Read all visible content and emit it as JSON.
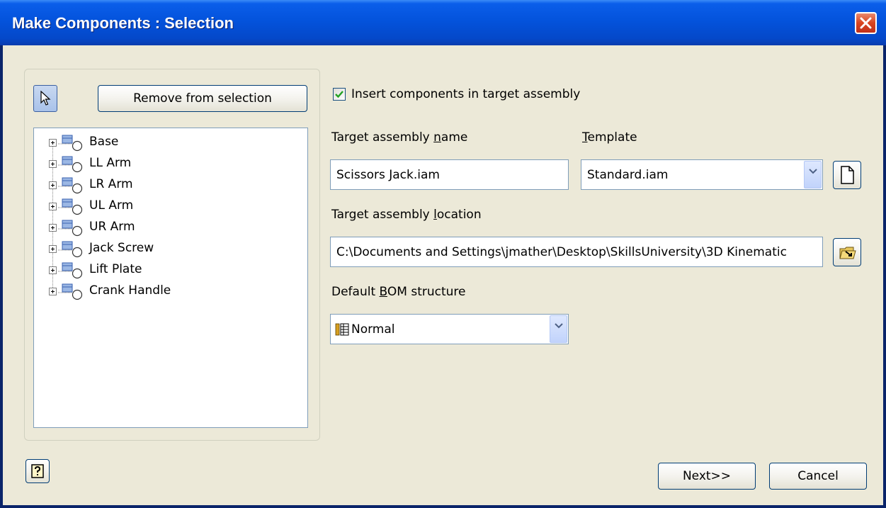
{
  "window": {
    "title": "Make Components : Selection"
  },
  "selection": {
    "remove_label": "Remove from selection",
    "items": [
      {
        "label": "Base"
      },
      {
        "label": "LL Arm"
      },
      {
        "label": "LR Arm"
      },
      {
        "label": "UL Arm"
      },
      {
        "label": "UR Arm"
      },
      {
        "label": "Jack Screw"
      },
      {
        "label": "Lift Plate"
      },
      {
        "label": "Crank Handle"
      }
    ]
  },
  "options": {
    "insert_checkbox_label": "Insert components in target assembly",
    "insert_checked": true,
    "target_name_label_pre": "Target assembly ",
    "target_name_label_u": "n",
    "target_name_label_post": "ame",
    "target_name_value": "Scissors Jack.iam",
    "template_label_u": "T",
    "template_label_post": "emplate",
    "template_value": "Standard.iam",
    "location_label_pre": "Target assembly ",
    "location_label_u": "l",
    "location_label_post": "ocation",
    "location_value": "C:\\Documents and Settings\\jmather\\Desktop\\SkillsUniversity\\3D Kinematic",
    "bom_label_pre": "Default ",
    "bom_label_u": "B",
    "bom_label_post": "OM structure",
    "bom_value": "Normal"
  },
  "footer": {
    "next_label": "Next>>",
    "cancel_label": "Cancel"
  },
  "colors": {
    "titlebar": "#0453DC",
    "dialog_bg": "#ECE9D8",
    "close": "#D9441E"
  },
  "icons": [
    "close-icon",
    "cursor-arrow-icon",
    "assembly-part-icon",
    "new-file-icon",
    "browse-folder-icon",
    "bom-structure-icon",
    "help-icon",
    "chevron-down-icon",
    "checkmark-icon"
  ]
}
